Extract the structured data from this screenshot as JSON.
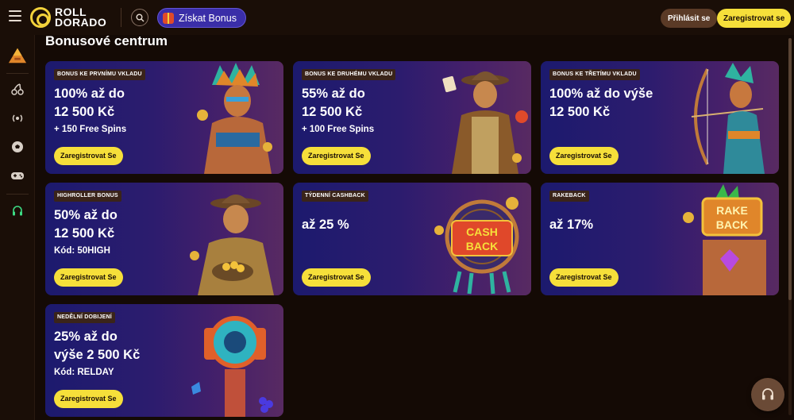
{
  "header": {
    "logo_line1": "ROLL",
    "logo_line2": "DORADO",
    "bonus_button": "Získat Bonus",
    "login_button": "Přihlásit se",
    "register_button": "Zaregistrovat se",
    "icons": [
      "menu-icon",
      "search-icon",
      "gift-icon"
    ]
  },
  "sidebar": {
    "items": [
      {
        "name": "pyramid-icon"
      },
      {
        "name": "cherries-icon"
      },
      {
        "name": "live-icon"
      },
      {
        "name": "soccer-ball-icon"
      },
      {
        "name": "gamepad-icon"
      },
      {
        "name": "headset-icon"
      }
    ]
  },
  "page": {
    "title": "Bonusové centrum"
  },
  "cards": [
    {
      "tag": "BONUS KE PRVNÍMU VKLADU",
      "line1": "100% až do",
      "line2": "12 500 Kč",
      "sub": "+ 150 Free Spins",
      "cta": "Zaregistrovat Se"
    },
    {
      "tag": "BONUS KE DRUHÉMU VKLADU",
      "line1": "55% až do",
      "line2": "12 500 Kč",
      "sub": "+ 100 Free Spins",
      "cta": "Zaregistrovat Se"
    },
    {
      "tag": "BONUS KE TŘETÍMU VKLADU",
      "line1": "100% až do výše",
      "line2": "12 500 Kč",
      "sub": "",
      "cta": "Zaregistrovat Se"
    },
    {
      "tag": "HIGHROLLER BONUS",
      "line1": "50% až do",
      "line2": "12 500 Kč",
      "sub": "Kód: 50HIGH",
      "cta": "Zaregistrovat Se"
    },
    {
      "tag": "TÝDENNÍ CASHBACK",
      "line1": "až 25 %",
      "line2": "",
      "sub": "",
      "cta": "Zaregistrovat Se",
      "art_text1": "CASH",
      "art_text2": "BACK"
    },
    {
      "tag": "RAKEBACK",
      "line1": "až 17%",
      "line2": "",
      "sub": "",
      "cta": "Zaregistrovat Se",
      "art_text1": "RAKE",
      "art_text2": "BACK"
    },
    {
      "tag": "NEDĚLNÍ DOBIJENÍ",
      "line1": "25% až do",
      "line2": "výše 2 500 Kč",
      "sub": "Kód: RELDAY",
      "cta": "Zaregistrovat Se"
    }
  ],
  "colors": {
    "accent_yellow": "#f6df3a",
    "bonus_purple": "#3a2ea8",
    "background": "#140a05"
  }
}
